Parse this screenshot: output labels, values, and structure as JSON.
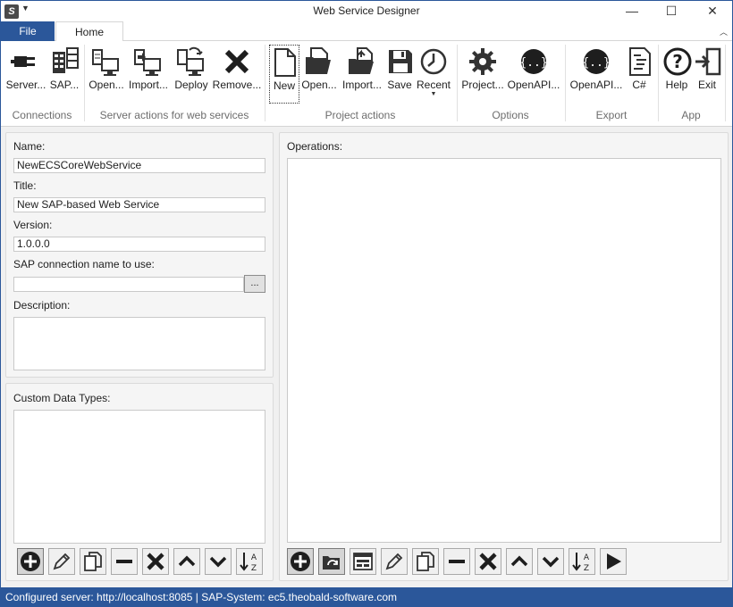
{
  "window": {
    "title": "Web Service Designer",
    "minimize": "—",
    "maximize": "☐",
    "close": "✕"
  },
  "tabs": {
    "file": "File",
    "home": "Home"
  },
  "ribbon": {
    "buttons": [
      {
        "label": "Server...",
        "icon": "plug-icon"
      },
      {
        "label": "SAP...",
        "icon": "server-grid-icon"
      },
      {
        "label": "Open...",
        "icon": "open-remote-icon"
      },
      {
        "label": "Import...",
        "icon": "import-remote-icon"
      },
      {
        "label": "Deploy",
        "icon": "deploy-icon"
      },
      {
        "label": "Remove...",
        "icon": "remove-x-icon"
      },
      {
        "label": "New",
        "icon": "new-document-icon"
      },
      {
        "label": "Open...",
        "icon": "open-folder-icon"
      },
      {
        "label": "Import...",
        "icon": "import-folder-icon"
      },
      {
        "label": "Save",
        "icon": "save-disk-icon"
      },
      {
        "label": "Recent",
        "icon": "clock-icon"
      },
      {
        "label": "Project...",
        "icon": "gear-icon"
      },
      {
        "label": "OpenAPI...",
        "icon": "openapi-icon"
      },
      {
        "label": "OpenAPI...",
        "icon": "openapi-icon"
      },
      {
        "label": "C#",
        "icon": "code-file-icon"
      },
      {
        "label": "Help",
        "icon": "help-icon"
      },
      {
        "label": "Exit",
        "icon": "exit-door-icon"
      }
    ],
    "groups": {
      "connections": "Connections",
      "server_actions": "Server actions for web services",
      "project_actions": "Project actions",
      "options": "Options",
      "export": "Export",
      "app": "App"
    }
  },
  "form": {
    "name_label": "Name:",
    "name_value": "NewECSCoreWebService",
    "title_label": "Title:",
    "title_value": "New SAP-based Web Service",
    "version_label": "Version:",
    "version_value": "1.0.0.0",
    "sap_conn_label": "SAP connection name to use:",
    "sap_conn_value": "",
    "browse_label": "...",
    "description_label": "Description:"
  },
  "custom_types": {
    "label": "Custom Data Types:"
  },
  "operations": {
    "label": "Operations:"
  },
  "status": "Configured server: http://localhost:8085 | SAP-System: ec5.theobald-software.com",
  "colors": {
    "accent": "#2b579a",
    "panel": "#f5f5f5"
  }
}
